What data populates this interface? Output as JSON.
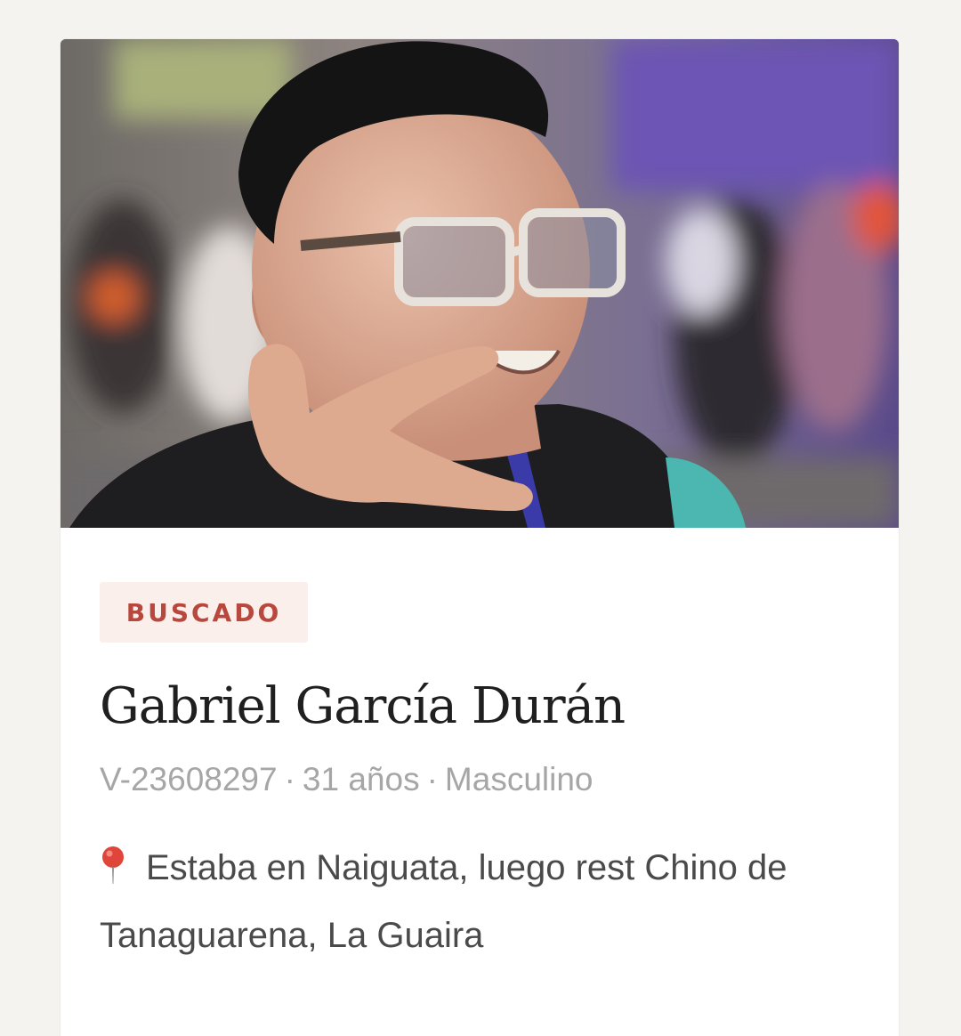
{
  "status_badge": "BUSCADO",
  "person": {
    "name": "Gabriel García Durán",
    "id_number": "V-23608297",
    "age": "31 años",
    "gender": "Masculino",
    "separator": "·",
    "location": "Estaba en Naiguata, luego rest Chino de Tanaguarena, La Guaira"
  },
  "icons": {
    "location": "map-pin-icon"
  },
  "colors": {
    "page_background": "#f4f3f0",
    "card_background": "#ffffff",
    "badge_background": "#fbefec",
    "badge_text": "#b8473d",
    "name_text": "#1f1f1f",
    "meta_text": "#a6a6a6",
    "location_text": "#4a4a4a",
    "pin": "#e0453a"
  }
}
